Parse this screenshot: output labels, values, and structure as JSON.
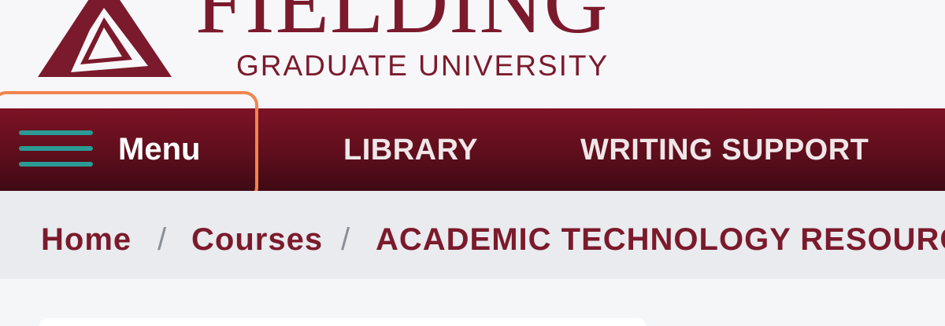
{
  "header": {
    "logo_word": "FIELDING",
    "logo_subtitle": "GRADUATE UNIVERSITY",
    "logo_icon": "fielding-triangle-logo-icon"
  },
  "navbar": {
    "menu_icon": "hamburger-menu-icon",
    "menu_label": "Menu",
    "links": [
      {
        "label": "LIBRARY"
      },
      {
        "label": "WRITING SUPPORT"
      }
    ]
  },
  "breadcrumb": {
    "items": [
      {
        "label": "Home"
      },
      {
        "label": "Courses"
      },
      {
        "label": "ACADEMIC TECHNOLOGY RESOURC"
      }
    ],
    "separator": "/"
  },
  "colors": {
    "brand": "#7b1a2c",
    "nav_bg": "#5e0e1c",
    "highlight": "#f2844d",
    "hamburger": "#2b9a94"
  }
}
